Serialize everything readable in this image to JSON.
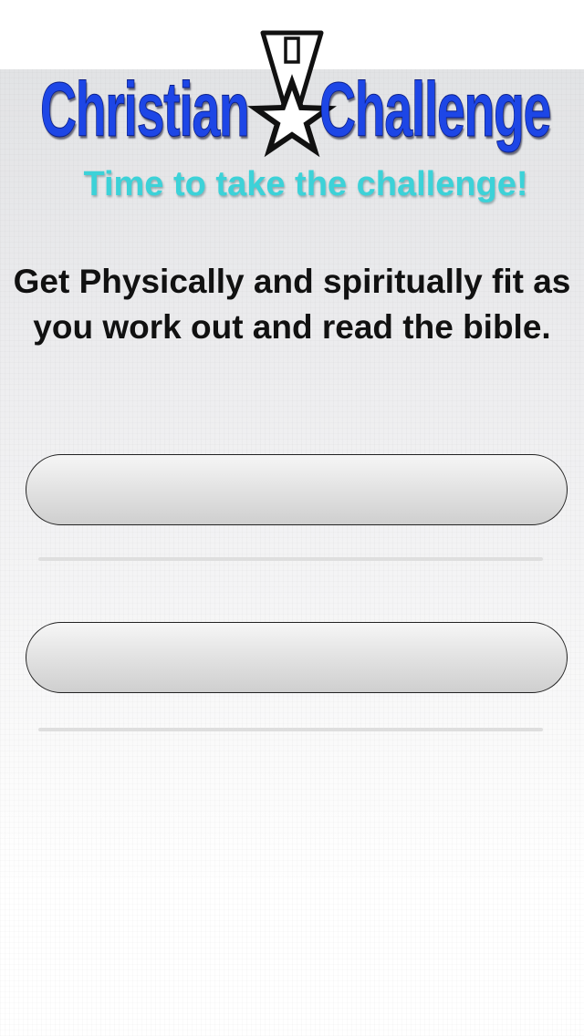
{
  "logo": {
    "word_left": "Christian",
    "word_right": "Challenge",
    "icon": "star-medal-icon"
  },
  "tagline": "Time to take the challenge!",
  "description": "Get Physically and spiritually fit as you work out and read the bible.",
  "buttons": [
    {
      "label": ""
    },
    {
      "label": ""
    }
  ],
  "colors": {
    "logo_blue": "#1d46e6",
    "tagline_teal": "#3cd2d8",
    "text": "#111111"
  }
}
